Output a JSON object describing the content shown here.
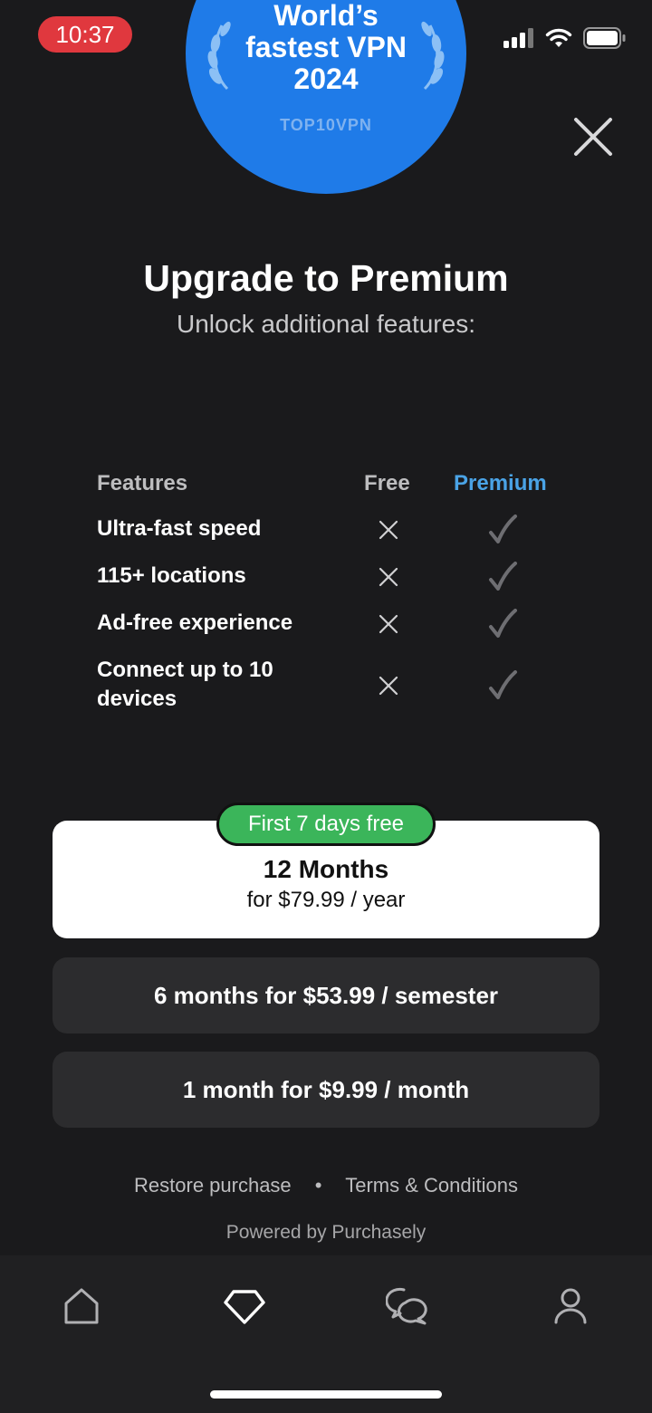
{
  "status_bar": {
    "time": "10:37"
  },
  "badge": {
    "line1": "World’s",
    "line2": "fastest VPN",
    "line3": "2024",
    "source": "TOP10VPN"
  },
  "header": {
    "title": "Upgrade to Premium",
    "subtitle": "Unlock additional features:"
  },
  "features": {
    "col_features": "Features",
    "col_free": "Free",
    "col_premium": "Premium",
    "rows": [
      {
        "label": "Ultra-fast speed"
      },
      {
        "label": "115+ locations"
      },
      {
        "label": "Ad-free experience"
      },
      {
        "label": "Connect up to 10 devices"
      }
    ]
  },
  "plans": {
    "trial_badge": "First 7 days free",
    "selected": {
      "title": "12 Months",
      "price": "for $79.99 / year"
    },
    "option2": "6 months for $53.99 / semester",
    "option3": "1 month for $9.99 / month"
  },
  "footer": {
    "restore": "Restore purchase",
    "separator": "•",
    "terms": "Terms & Conditions",
    "powered": "Powered by Purchasely"
  },
  "colors": {
    "background": "#1a1a1c",
    "premium_accent": "#4aa3e6",
    "badge_blue": "#1f7be8",
    "trial_green": "#3bb55a",
    "time_pill": "#e0383e"
  },
  "nav_icons": [
    "home-icon",
    "diamond-icon",
    "chat-icon",
    "profile-icon"
  ]
}
